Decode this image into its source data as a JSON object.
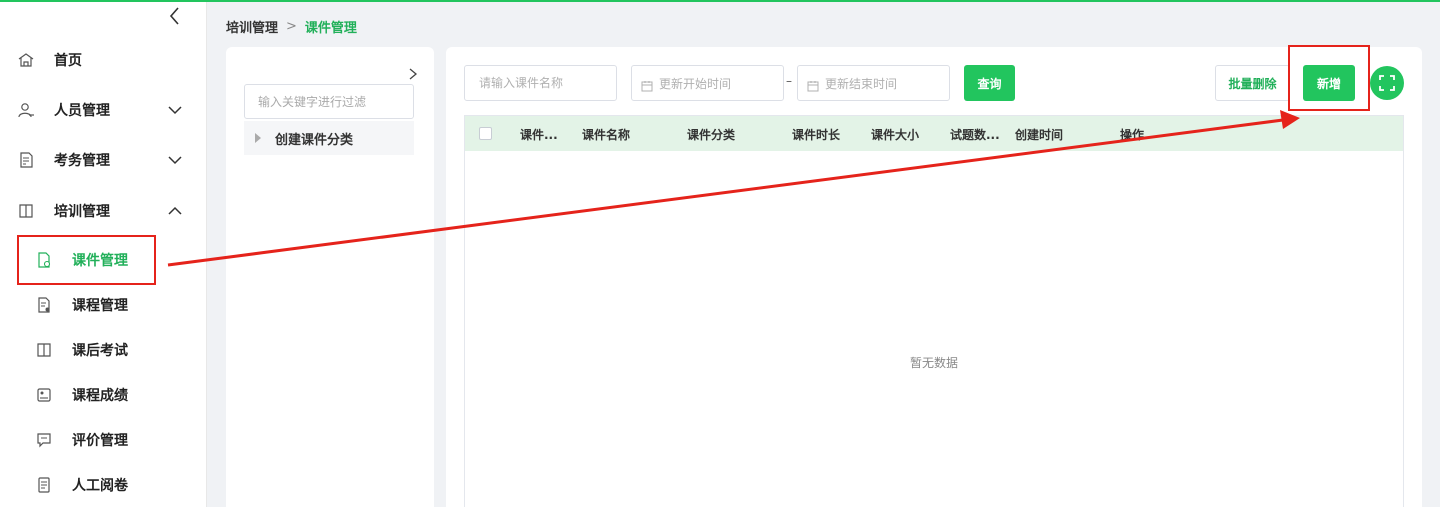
{
  "breadcrumb": {
    "parent": "培训管理",
    "separator": ">",
    "current": "课件管理"
  },
  "sidebar": {
    "items": [
      {
        "label": "首页"
      },
      {
        "label": "人员管理"
      },
      {
        "label": "考务管理"
      },
      {
        "label": "培训管理"
      }
    ],
    "sub_items": [
      {
        "label": "课件管理"
      },
      {
        "label": "课程管理"
      },
      {
        "label": "课后考试"
      },
      {
        "label": "课程成绩"
      },
      {
        "label": "评价管理"
      },
      {
        "label": "人工阅卷"
      }
    ]
  },
  "category_panel": {
    "filter_placeholder": "输入关键字进行过滤",
    "tree_node_label": "创建课件分类"
  },
  "toolbar": {
    "name_placeholder": "请输入课件名称",
    "start_date_placeholder": "更新开始时间",
    "date_separator": "–",
    "end_date_placeholder": "更新结束时间",
    "query_label": "查询",
    "batch_delete_label": "批量删除",
    "add_label": "新增"
  },
  "table": {
    "columns": [
      "课件...",
      "课件名称",
      "课件分类",
      "课件时长",
      "课件大小",
      "试题数...",
      "创建时间",
      "操作"
    ],
    "rows": [],
    "empty_text": "暂无数据"
  },
  "colors": {
    "accent": "#22c55e",
    "annotation": "#e5231b"
  }
}
